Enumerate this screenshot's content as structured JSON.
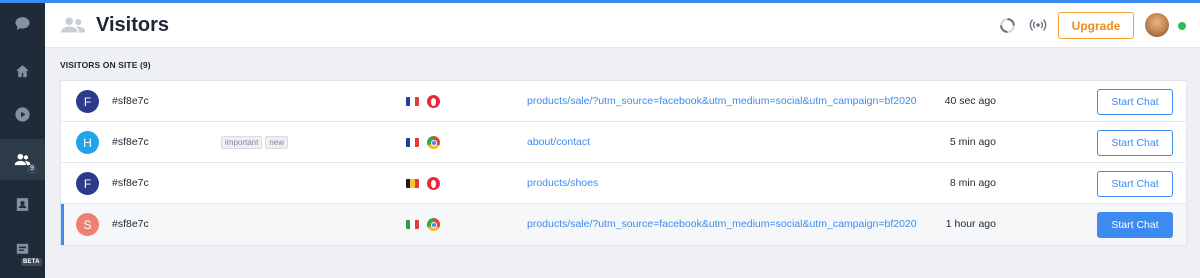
{
  "app": {
    "accent_color": "#3d8bf0",
    "upgrade_color": "#f08c1b",
    "online_color": "#2bbf4f"
  },
  "sidebar": {
    "items": [
      {
        "icon": "chat-bubble-icon",
        "active": false
      },
      {
        "icon": "home-icon",
        "active": false
      },
      {
        "icon": "play-icon",
        "active": false
      },
      {
        "icon": "visitors-icon",
        "active": true,
        "badge": "9"
      },
      {
        "icon": "contacts-icon",
        "active": false
      },
      {
        "icon": "inbox-icon",
        "active": false,
        "badge": "BETA"
      }
    ]
  },
  "header": {
    "icon": "visitors-icon",
    "title": "Visitors",
    "upgrade_label": "Upgrade",
    "status_icon": "loading-circle-icon",
    "broadcast_icon": "broadcast-icon",
    "avatar": "user-avatar"
  },
  "section": {
    "label": "VISITORS ON SITE (9)"
  },
  "visitors": [
    {
      "initial": "F",
      "avatar_color": "#2c3a8c",
      "id": "#sf8e7c",
      "tags": [],
      "flag": [
        "#1f3fa6",
        "#ffffff",
        "#e23b3b"
      ],
      "browser": "opera",
      "page": "products/sale/?utm_source=facebook&utm_medium=social&utm_campaign=bf2020",
      "time": "40 sec ago",
      "action": "Start Chat",
      "selected": false
    },
    {
      "initial": "H",
      "avatar_color": "#22a4e8",
      "id": "#sf8e7c",
      "tags": [
        "important",
        "new"
      ],
      "flag": [
        "#1f3fa6",
        "#ffffff",
        "#e23b3b"
      ],
      "browser": "chrome",
      "page": "about/contact",
      "time": "5 min ago",
      "action": "Start Chat",
      "selected": false
    },
    {
      "initial": "F",
      "avatar_color": "#2c3a8c",
      "id": "#sf8e7c",
      "tags": [],
      "flag": [
        "#1b1b1b",
        "#f4c531",
        "#e23b3b"
      ],
      "browser": "opera",
      "page": "products/shoes",
      "time": "8 min ago",
      "action": "Start Chat",
      "selected": false
    },
    {
      "initial": "S",
      "avatar_color": "#ec8173",
      "id": "#sf8e7c",
      "tags": [],
      "flag": [
        "#2e9a48",
        "#ffffff",
        "#e23b3b"
      ],
      "browser": "chrome",
      "page": "products/sale/?utm_source=facebook&utm_medium=social&utm_campaign=bf2020",
      "time": "1 hour ago",
      "action": "Start Chat",
      "selected": true
    }
  ]
}
